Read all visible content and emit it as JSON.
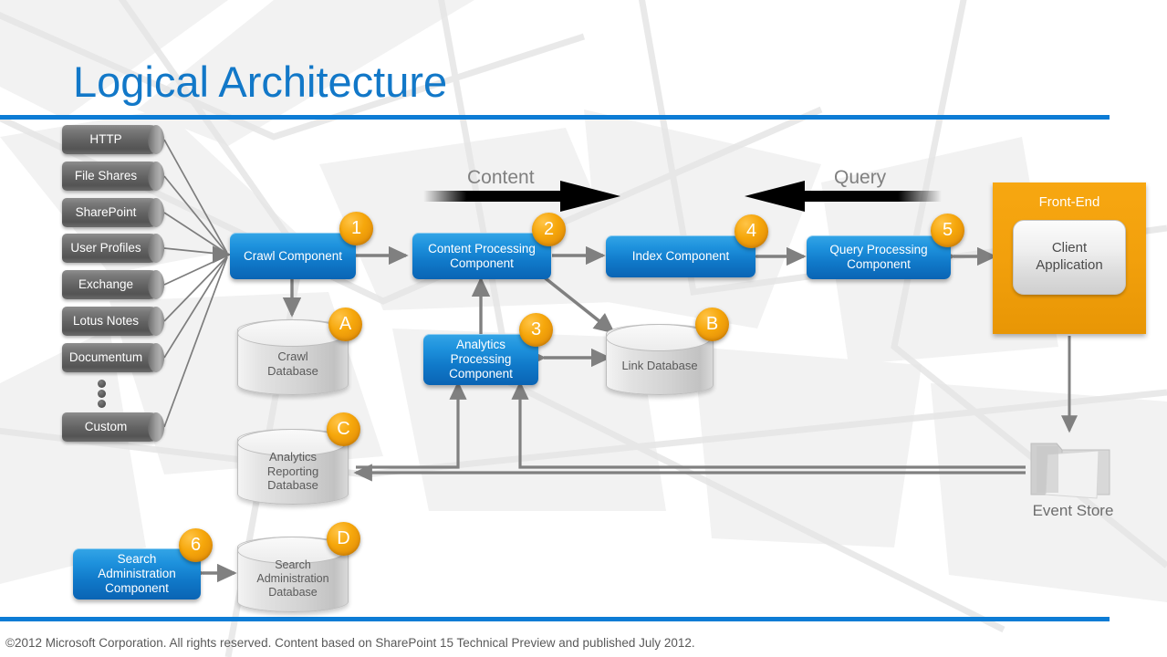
{
  "page": {
    "title": "Logical Architecture",
    "footer": "©2012 Microsoft Corporation. All rights reserved. Content based on SharePoint 15 Technical Preview and published July 2012.",
    "accent_blue": "#0c7cd5",
    "title_color": "#1278c8",
    "component_blue": "#1079c9",
    "badge_orange": "#f2a00c",
    "frontend_orange": "#f2a00c",
    "database_gray": "#d2d2d2",
    "source_gray": "#636363"
  },
  "sources": {
    "items": [
      {
        "label": "HTTP"
      },
      {
        "label": "File Shares"
      },
      {
        "label": "SharePoint"
      },
      {
        "label": "User Profiles"
      },
      {
        "label": "Exchange"
      },
      {
        "label": "Lotus Notes"
      },
      {
        "label": "Documentum"
      },
      {
        "label": "Custom"
      }
    ],
    "ellipsis": "⋮"
  },
  "flow_labels": {
    "content": "Content",
    "query": "Query"
  },
  "components": [
    {
      "id": "crawl",
      "label": "Crawl Component",
      "badge": "1"
    },
    {
      "id": "content",
      "label": "Content Processing\nComponent",
      "badge": "2"
    },
    {
      "id": "analytics",
      "label": "Analytics\nProcessing\nComponent",
      "badge": "3"
    },
    {
      "id": "index",
      "label": "Index Component",
      "badge": "4"
    },
    {
      "id": "query",
      "label": "Query Processing\nComponent",
      "badge": "5"
    },
    {
      "id": "searchadmin",
      "label": "Search\nAdministration\nComponent",
      "badge": "6"
    }
  ],
  "databases": [
    {
      "id": "crawl-db",
      "label": "Crawl\nDatabase",
      "badge": "A"
    },
    {
      "id": "link-db",
      "label": "Link Database",
      "badge": "B"
    },
    {
      "id": "analytics-db",
      "label": "Analytics\nReporting\nDatabase",
      "badge": "C"
    },
    {
      "id": "searchadmin-db",
      "label": "Search\nAdministration\nDatabase",
      "badge": "D"
    }
  ],
  "front_end": {
    "title": "Front-End",
    "client_app": "Client\nApplication"
  },
  "event_store": {
    "label": "Event Store"
  }
}
